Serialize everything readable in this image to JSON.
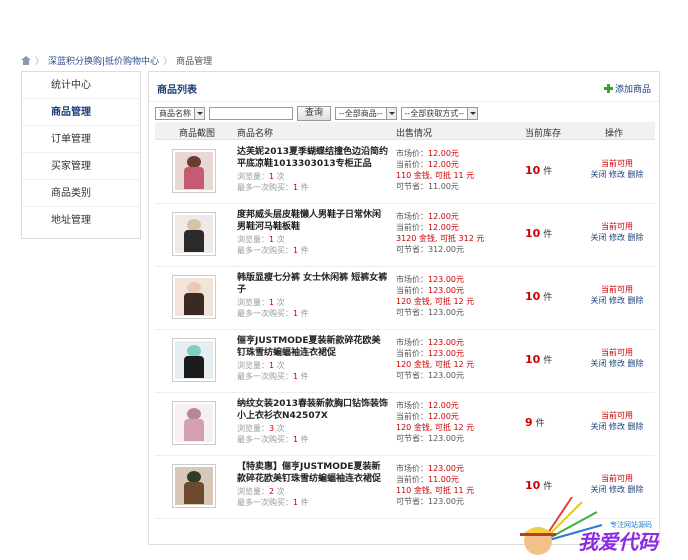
{
  "breadcrumb": {
    "parent": "深蓝积分换购|抵价购物中心",
    "current": "商品管理"
  },
  "sidebar": {
    "items": [
      {
        "label": "统计中心"
      },
      {
        "label": "商品管理"
      },
      {
        "label": "订单管理"
      },
      {
        "label": "买家管理"
      },
      {
        "label": "商品类别"
      },
      {
        "label": "地址管理"
      }
    ]
  },
  "panel": {
    "title": "商品列表",
    "add_label": "添加商品"
  },
  "filters": {
    "field": "商品名称",
    "query": "查询",
    "all_goods": "--全部商品--",
    "all_methods": "--全部获取方式--"
  },
  "table": {
    "headers": [
      "商品截图",
      "商品名称",
      "出售情况",
      "当前库存",
      "操作"
    ],
    "labels": {
      "market": "市场价：",
      "current": "当前价：",
      "save": "可节省：",
      "views": "浏览量：",
      "max_buy": "最多一次购买：",
      "times": "次",
      "pieces": "件"
    },
    "rows": [
      {
        "name": "达芙妮2013夏季蝴蝶结撞色边沿简约平底凉鞋1013303013专柜正品",
        "views": "1",
        "max": "1",
        "market": "12.00元",
        "current": "12.00元",
        "deal": "110 金钱, 可抵 11 元",
        "save": "11.00元",
        "stock": "10",
        "status": "当前可用",
        "actions": "关闭 修改 删除"
      },
      {
        "name": "度邦威头层皮鞋懒人男鞋子日常休闲男鞋河马鞋板鞋",
        "views": "1",
        "max": "1",
        "market": "12.00元",
        "current": "12.00元",
        "deal": "3120 金钱, 可抵 312 元",
        "save": "312.00元",
        "stock": "10",
        "status": "当前可用",
        "actions": "关闭 修改 删除"
      },
      {
        "name": "韩版显瘦七分裤 女士休闲裤 短裤女裤子",
        "views": "1",
        "max": "1",
        "market": "123.00元",
        "current": "123.00元",
        "deal": "120 金钱, 可抵 12 元",
        "save": "123.00元",
        "stock": "10",
        "status": "当前可用",
        "actions": "关闭 修改 删除"
      },
      {
        "name": "俪亨JUSTMODE夏装新款碎花欧美钉珠雪纺蝙蝠袖连衣裙促",
        "views": "1",
        "max": "1",
        "market": "123.00元",
        "current": "123.00元",
        "deal": "120 金钱, 可抵 12 元",
        "save": "123.00元",
        "stock": "10",
        "status": "当前可用",
        "actions": "关闭 修改 删除"
      },
      {
        "name": "纳纹女装2013春装新款胸口钻饰装饰小上衣衫衣N42507X",
        "views": "3",
        "max": "1",
        "market": "12.00元",
        "current": "12.00元",
        "deal": "120 金钱, 可抵 12 元",
        "save": "123.00元",
        "stock": "9",
        "status": "当前可用",
        "actions": "关闭 修改 删除"
      },
      {
        "name": "【特卖惠】俪亨JUSTMODE夏装新款碎花欧美钉珠雪纺蝙蝠袖连衣裙促",
        "views": "2",
        "max": "1",
        "market": "123.00元",
        "current": "11.00元",
        "deal": "110 金钱, 可抵 11 元",
        "save": "123.00元",
        "stock": "10",
        "status": "当前可用",
        "actions": "关闭 修改 删除"
      }
    ]
  },
  "watermark": {
    "text": "我爱代码",
    "subtext": "专注网站源码"
  },
  "colors": {
    "accent": "#1d3f7a",
    "price_red": "#cc0000",
    "add_green": "#3aa32c"
  }
}
